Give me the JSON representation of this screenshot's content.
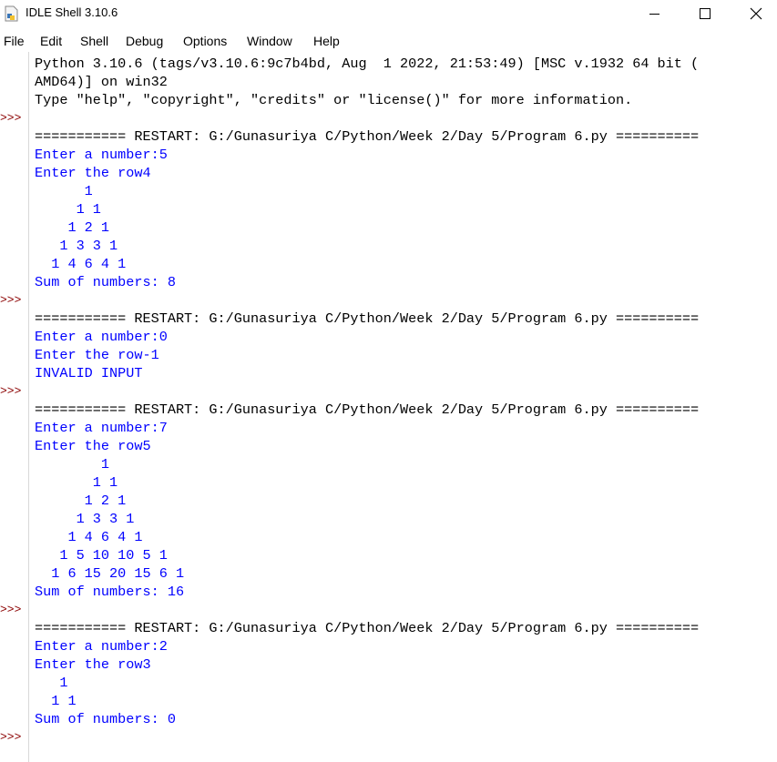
{
  "window": {
    "title": "IDLE Shell 3.10.6"
  },
  "menu": [
    "File",
    "Edit",
    "Shell",
    "Debug",
    "Options",
    "Window",
    "Help"
  ],
  "prompt": ">>>",
  "lines": [
    {
      "text": "Python 3.10.6 (tags/v3.10.6:9c7b4bd, Aug  1 2022, 21:53:49) [MSC v.1932 64 bit (",
      "style": "plain"
    },
    {
      "text": "AMD64)] on win32",
      "style": "plain"
    },
    {
      "text": "Type \"help\", \"copyright\", \"credits\" or \"license()\" for more information.",
      "style": "plain"
    },
    {
      "text": "",
      "style": "plain"
    },
    {
      "text": "=========== RESTART: G:/Gunasuriya C/Python/Week 2/Day 5/Program 6.py ==========",
      "style": "plain"
    },
    {
      "text": "Enter a number:5",
      "style": "out"
    },
    {
      "text": "Enter the row4",
      "style": "out"
    },
    {
      "text": "      1",
      "style": "out"
    },
    {
      "text": "     1 1",
      "style": "out"
    },
    {
      "text": "    1 2 1",
      "style": "out"
    },
    {
      "text": "   1 3 3 1",
      "style": "out"
    },
    {
      "text": "  1 4 6 4 1",
      "style": "out"
    },
    {
      "text": "Sum of numbers: 8",
      "style": "out"
    },
    {
      "text": "",
      "style": "plain"
    },
    {
      "text": "=========== RESTART: G:/Gunasuriya C/Python/Week 2/Day 5/Program 6.py ==========",
      "style": "plain"
    },
    {
      "text": "Enter a number:0",
      "style": "out"
    },
    {
      "text": "Enter the row-1",
      "style": "out"
    },
    {
      "text": "INVALID INPUT",
      "style": "out"
    },
    {
      "text": "",
      "style": "plain"
    },
    {
      "text": "=========== RESTART: G:/Gunasuriya C/Python/Week 2/Day 5/Program 6.py ==========",
      "style": "plain"
    },
    {
      "text": "Enter a number:7",
      "style": "out"
    },
    {
      "text": "Enter the row5",
      "style": "out"
    },
    {
      "text": "        1",
      "style": "out"
    },
    {
      "text": "       1 1",
      "style": "out"
    },
    {
      "text": "      1 2 1",
      "style": "out"
    },
    {
      "text": "     1 3 3 1",
      "style": "out"
    },
    {
      "text": "    1 4 6 4 1",
      "style": "out"
    },
    {
      "text": "   1 5 10 10 5 1",
      "style": "out"
    },
    {
      "text": "  1 6 15 20 15 6 1",
      "style": "out"
    },
    {
      "text": "Sum of numbers: 16",
      "style": "out"
    },
    {
      "text": "",
      "style": "plain"
    },
    {
      "text": "=========== RESTART: G:/Gunasuriya C/Python/Week 2/Day 5/Program 6.py ==========",
      "style": "plain"
    },
    {
      "text": "Enter a number:2",
      "style": "out"
    },
    {
      "text": "Enter the row3",
      "style": "out"
    },
    {
      "text": "   1",
      "style": "out"
    },
    {
      "text": "  1 1",
      "style": "out"
    },
    {
      "text": "Sum of numbers: 0",
      "style": "out"
    }
  ],
  "prompt_lines": [
    3,
    13,
    18,
    30,
    37
  ],
  "colors": {
    "stdout": "#0000ff",
    "prompt": "#8b0000",
    "text": "#000000"
  }
}
